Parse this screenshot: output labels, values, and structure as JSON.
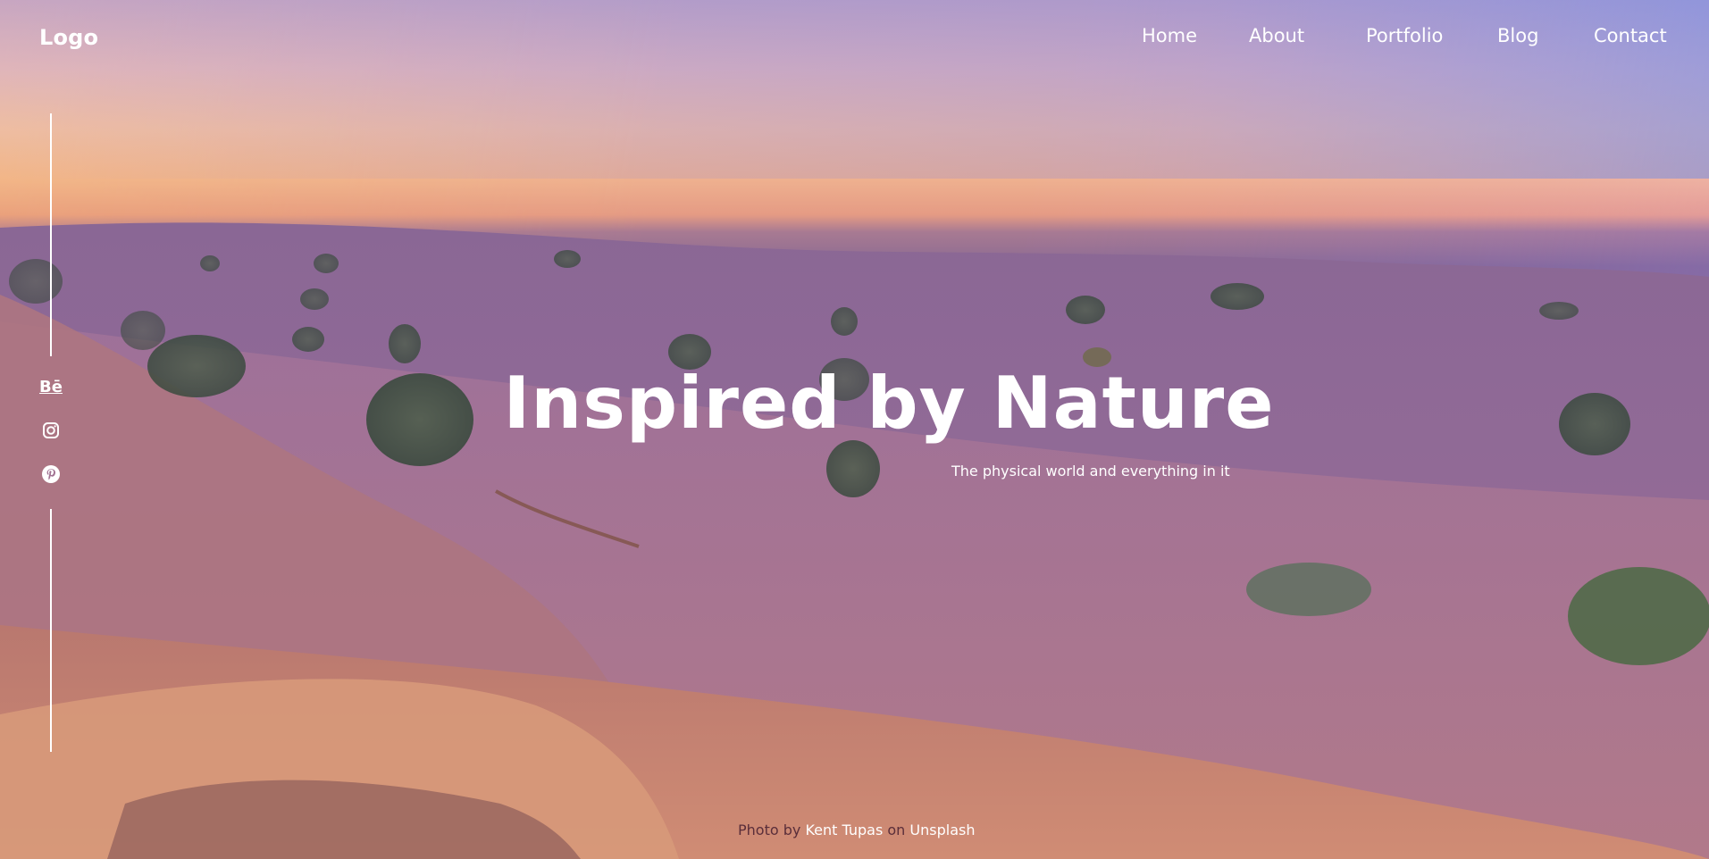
{
  "header": {
    "logo": "Logo",
    "nav": [
      "Home",
      "About",
      "Portfolio",
      "Blog",
      "Contact"
    ]
  },
  "social": {
    "icons": [
      "behance-icon",
      "instagram-icon",
      "pinterest-icon"
    ],
    "behance_glyph": "Bē"
  },
  "hero": {
    "title": "Inspired by Nature",
    "subtitle": "The physical world and everything in it"
  },
  "credit": {
    "prefix": "Photo by",
    "author": "Kent Tupas",
    "on": "on",
    "site": "Unsplash"
  },
  "colors": {
    "text": "#ffffff",
    "credit_muted": "#5a2e3a"
  }
}
